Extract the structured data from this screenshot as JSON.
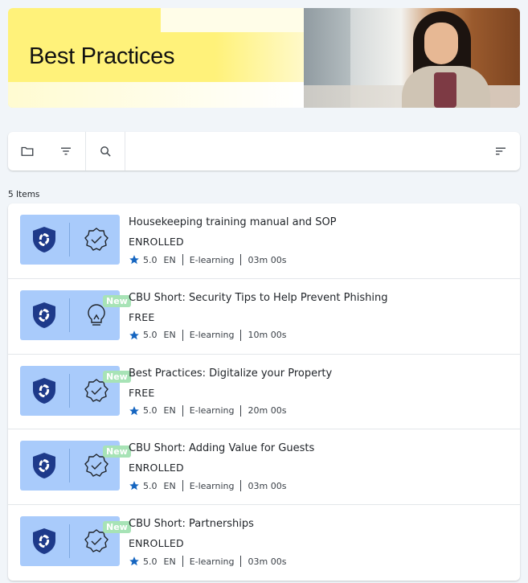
{
  "hero": {
    "title": "Best Practices"
  },
  "toolbar": {
    "folder_icon": "folder-icon",
    "filter_icon": "filter-icon",
    "search_icon": "search-icon",
    "sort_icon": "sort-icon"
  },
  "items_count": "5 Items",
  "colors": {
    "thumb_bg": "#a9cbfb",
    "shield": "#1e3a8a",
    "badge_bg": "#a7e3b6",
    "star": "#1565c0",
    "hero_yellow": "#fff27a"
  },
  "items": [
    {
      "title": "Housekeeping training manual and SOP",
      "status": "ENROLLED",
      "rating": "5.0",
      "language": "EN",
      "type": "E-learning",
      "duration": "03m 00s",
      "badge": "",
      "icon": "badge-check-icon"
    },
    {
      "title": "CBU Short: Security Tips to Help Prevent Phishing",
      "status": "FREE",
      "rating": "5.0",
      "language": "EN",
      "type": "E-learning",
      "duration": "10m 00s",
      "badge": "New",
      "icon": "lightbulb-icon"
    },
    {
      "title": "Best Practices: Digitalize your Property",
      "status": "FREE",
      "rating": "5.0",
      "language": "EN",
      "type": "E-learning",
      "duration": "20m 00s",
      "badge": "New",
      "icon": "badge-check-icon"
    },
    {
      "title": "CBU Short: Adding Value for Guests",
      "status": "ENROLLED",
      "rating": "5.0",
      "language": "EN",
      "type": "E-learning",
      "duration": "03m 00s",
      "badge": "New",
      "icon": "badge-check-icon"
    },
    {
      "title": "CBU Short: Partnerships",
      "status": "ENROLLED",
      "rating": "5.0",
      "language": "EN",
      "type": "E-learning",
      "duration": "03m 00s",
      "badge": "New",
      "icon": "badge-check-icon"
    }
  ]
}
